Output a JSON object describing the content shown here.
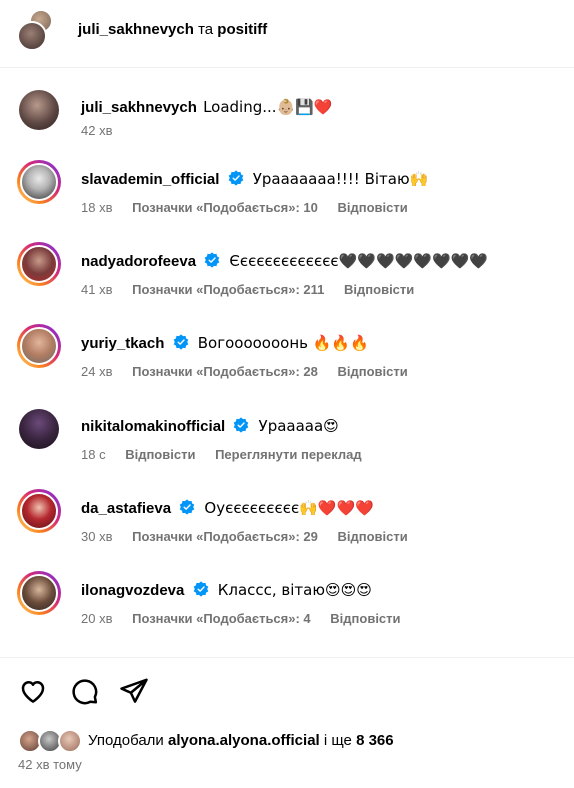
{
  "header": {
    "user1": "juli_sakhnevych",
    "conjunction": "та",
    "user2": "positiff"
  },
  "caption": {
    "username": "juli_sakhnevych",
    "text": "Loading...👶🏼💾❤️",
    "time": "42 хв"
  },
  "comments": [
    {
      "username": "slavademin_official",
      "text": "Урааааааа!!!! Вітаю🙌",
      "time": "18 хв",
      "likes": "Позначки «Подобається»: 10",
      "reply": "Відповісти"
    },
    {
      "username": "nadyadorofeeva",
      "text": "Єєєєєєєєєєєєє🖤🖤🖤🖤🖤🖤🖤🖤",
      "time": "41 хв",
      "likes": "Позначки «Подобається»: 211",
      "reply": "Відповісти"
    },
    {
      "username": "yuriy_tkach",
      "text": "Вогооооооонь 🔥🔥🔥",
      "time": "24 хв",
      "likes": "Позначки «Подобається»: 28",
      "reply": "Відповісти"
    },
    {
      "username": "nikitalomakinofficial",
      "text": "Урааааа😍",
      "time": "18 с",
      "reply": "Відповісти",
      "translate": "Переглянути переклад"
    },
    {
      "username": "da_astafieva",
      "text": "Оуєєєєєєєєє🙌❤️❤️❤️",
      "time": "30 хв",
      "likes": "Позначки «Подобається»: 29",
      "reply": "Відповісти"
    },
    {
      "username": "ilonagvozdeva",
      "text": "Классс, вітаю😍😍😍",
      "time": "20 хв",
      "likes": "Позначки «Подобається»: 4",
      "reply": "Відповісти"
    }
  ],
  "liked_by": {
    "prefix": "Уподобали",
    "user": "alyona.alyona.official",
    "and": "і ще",
    "count": "8 366"
  },
  "post_time": "42 хв тому",
  "colors": {
    "verified": "#0095f6",
    "secondary_text": "#737373"
  }
}
